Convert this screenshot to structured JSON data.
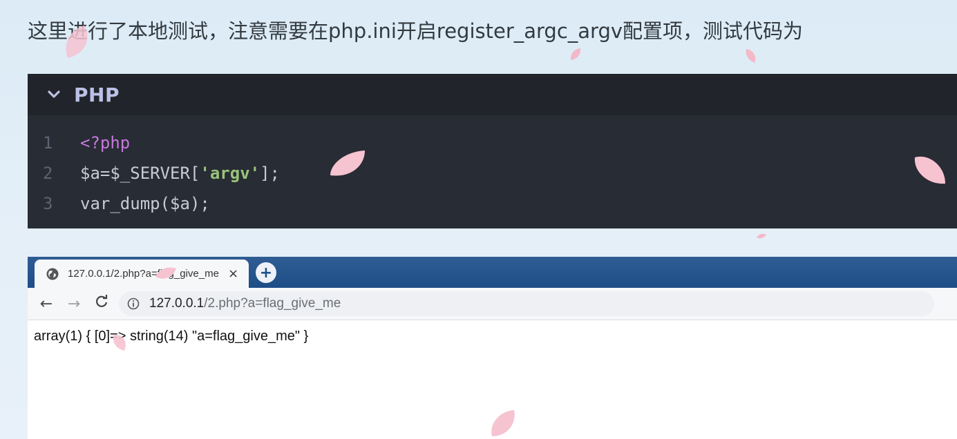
{
  "intro": {
    "text": "这里进行了本地测试，注意需要在php.ini开启register_argc_argv配置项，测试代码为"
  },
  "code_block": {
    "language": "PHP",
    "lines": [
      {
        "num": "1",
        "tokens": [
          {
            "type": "tag",
            "text": "<?php"
          }
        ]
      },
      {
        "num": "2",
        "tokens": [
          {
            "type": "default",
            "text": "$a=$_SERVER["
          },
          {
            "type": "string",
            "text": "'argv'"
          },
          {
            "type": "default",
            "text": "];"
          }
        ]
      },
      {
        "num": "3",
        "tokens": [
          {
            "type": "default",
            "text": "var_dump($a);"
          }
        ]
      }
    ]
  },
  "browser": {
    "tab": {
      "title": "127.0.0.1/2.php?a=flag_give_me",
      "favicon": "globe-icon",
      "close": "×"
    },
    "new_tab": "+",
    "nav": {
      "back": "←",
      "forward": "→",
      "reload": "C"
    },
    "url": {
      "host": "127.0.0.1",
      "rest": "/2.php?a=flag_give_me"
    },
    "content": "array(1) { [0]=> string(14) \"a=flag_give_me\" }"
  },
  "colors": {
    "code_bg": "#282c34",
    "code_header_bg": "#21252b",
    "tag": "#c678dd",
    "string": "#98c379",
    "tabbar": "#1e4e87",
    "petal": "#f6c3d0"
  }
}
